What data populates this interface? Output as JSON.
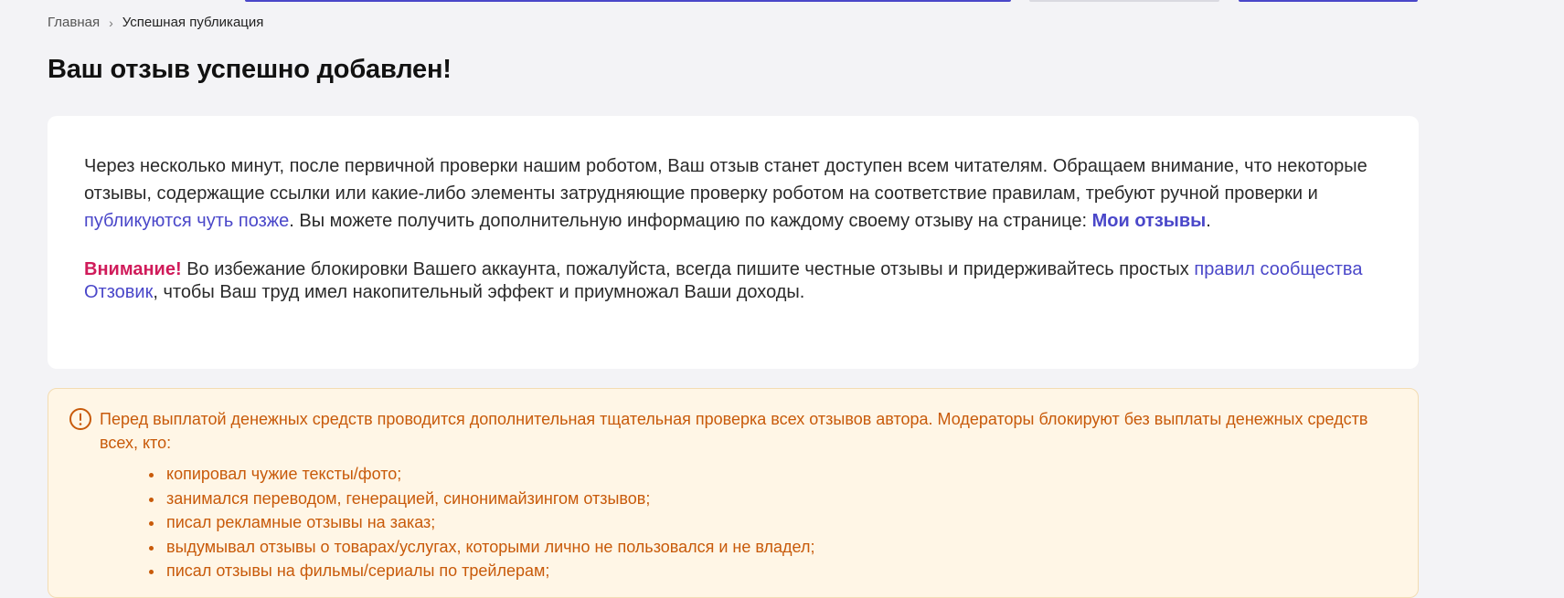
{
  "breadcrumb": {
    "home": "Главная",
    "separator": "›",
    "current": "Успешная публикация"
  },
  "page_title": "Ваш отзыв успешно добавлен!",
  "info_card": {
    "para1_text_a": "Через несколько минут, после первичной проверки нашим роботом, Ваш отзыв станет доступен всем читателям. Обращаем внимание, что некоторые отзывы, содержащие ссылки или какие-либо элементы затрудняющие проверку роботом на соответствие правилам, требуют ручной проверки и ",
    "para1_link": "публикуются чуть позже",
    "para1_text_b": ". Вы можете получить дополнительную информацию по каждому своему отзыву на странице: ",
    "my_reviews_link": "Мои отзывы",
    "para1_end": ".",
    "attention_label": "Внимание!",
    "para2_text_a": " Во избежание блокировки Вашего аккаунта, пожалуйста, всегда пишите честные отзывы и придерживайтесь простых ",
    "rules_link": "правил сообщества Отзовик",
    "para2_text_b": ", чтобы Ваш труд имел накопительный эффект и приумножал Ваши доходы."
  },
  "warning": {
    "icon": "exclamation-circle-icon",
    "text": "Перед выплатой денежных средств проводится дополнительная тщательная проверка всех отзывов автора. Модераторы блокируют без выплаты денежных средств всех, кто:",
    "items": [
      "копировал чужие тексты/фото;",
      "занимался переводом, генерацией, синонимайзингом отзывов;",
      "писал рекламные отзывы на заказ;",
      "выдумывал отзывы о товарах/услугах, которыми лично не пользовался и не владел;",
      "писал отзывы на фильмы/сериалы по трейлерам;"
    ]
  },
  "colors": {
    "accent": "#4a47c9",
    "attention": "#d01b5a",
    "warning_text": "#c85a0a",
    "warning_bg": "#fff6e6"
  }
}
